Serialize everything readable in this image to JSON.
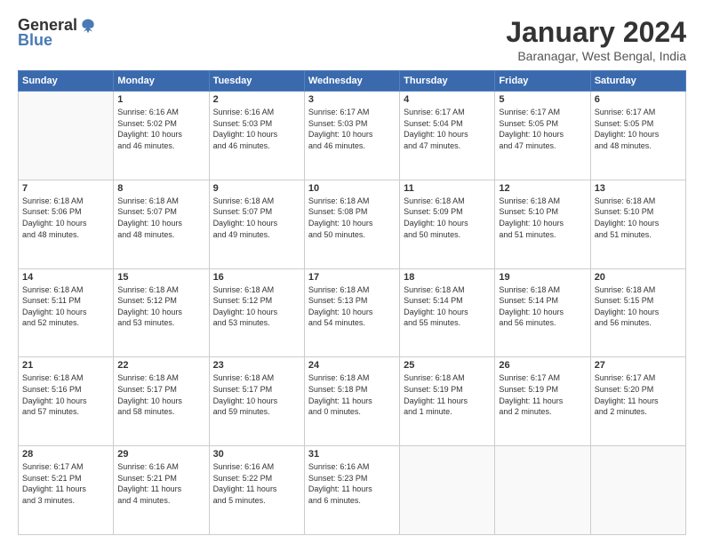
{
  "header": {
    "logo_general": "General",
    "logo_blue": "Blue",
    "month_title": "January 2024",
    "subtitle": "Baranagar, West Bengal, India"
  },
  "columns": [
    "Sunday",
    "Monday",
    "Tuesday",
    "Wednesday",
    "Thursday",
    "Friday",
    "Saturday"
  ],
  "weeks": [
    [
      {
        "day": "",
        "info": ""
      },
      {
        "day": "1",
        "info": "Sunrise: 6:16 AM\nSunset: 5:02 PM\nDaylight: 10 hours\nand 46 minutes."
      },
      {
        "day": "2",
        "info": "Sunrise: 6:16 AM\nSunset: 5:03 PM\nDaylight: 10 hours\nand 46 minutes."
      },
      {
        "day": "3",
        "info": "Sunrise: 6:17 AM\nSunset: 5:03 PM\nDaylight: 10 hours\nand 46 minutes."
      },
      {
        "day": "4",
        "info": "Sunrise: 6:17 AM\nSunset: 5:04 PM\nDaylight: 10 hours\nand 47 minutes."
      },
      {
        "day": "5",
        "info": "Sunrise: 6:17 AM\nSunset: 5:05 PM\nDaylight: 10 hours\nand 47 minutes."
      },
      {
        "day": "6",
        "info": "Sunrise: 6:17 AM\nSunset: 5:05 PM\nDaylight: 10 hours\nand 48 minutes."
      }
    ],
    [
      {
        "day": "7",
        "info": "Sunrise: 6:18 AM\nSunset: 5:06 PM\nDaylight: 10 hours\nand 48 minutes."
      },
      {
        "day": "8",
        "info": "Sunrise: 6:18 AM\nSunset: 5:07 PM\nDaylight: 10 hours\nand 48 minutes."
      },
      {
        "day": "9",
        "info": "Sunrise: 6:18 AM\nSunset: 5:07 PM\nDaylight: 10 hours\nand 49 minutes."
      },
      {
        "day": "10",
        "info": "Sunrise: 6:18 AM\nSunset: 5:08 PM\nDaylight: 10 hours\nand 50 minutes."
      },
      {
        "day": "11",
        "info": "Sunrise: 6:18 AM\nSunset: 5:09 PM\nDaylight: 10 hours\nand 50 minutes."
      },
      {
        "day": "12",
        "info": "Sunrise: 6:18 AM\nSunset: 5:10 PM\nDaylight: 10 hours\nand 51 minutes."
      },
      {
        "day": "13",
        "info": "Sunrise: 6:18 AM\nSunset: 5:10 PM\nDaylight: 10 hours\nand 51 minutes."
      }
    ],
    [
      {
        "day": "14",
        "info": "Sunrise: 6:18 AM\nSunset: 5:11 PM\nDaylight: 10 hours\nand 52 minutes."
      },
      {
        "day": "15",
        "info": "Sunrise: 6:18 AM\nSunset: 5:12 PM\nDaylight: 10 hours\nand 53 minutes."
      },
      {
        "day": "16",
        "info": "Sunrise: 6:18 AM\nSunset: 5:12 PM\nDaylight: 10 hours\nand 53 minutes."
      },
      {
        "day": "17",
        "info": "Sunrise: 6:18 AM\nSunset: 5:13 PM\nDaylight: 10 hours\nand 54 minutes."
      },
      {
        "day": "18",
        "info": "Sunrise: 6:18 AM\nSunset: 5:14 PM\nDaylight: 10 hours\nand 55 minutes."
      },
      {
        "day": "19",
        "info": "Sunrise: 6:18 AM\nSunset: 5:14 PM\nDaylight: 10 hours\nand 56 minutes."
      },
      {
        "day": "20",
        "info": "Sunrise: 6:18 AM\nSunset: 5:15 PM\nDaylight: 10 hours\nand 56 minutes."
      }
    ],
    [
      {
        "day": "21",
        "info": "Sunrise: 6:18 AM\nSunset: 5:16 PM\nDaylight: 10 hours\nand 57 minutes."
      },
      {
        "day": "22",
        "info": "Sunrise: 6:18 AM\nSunset: 5:17 PM\nDaylight: 10 hours\nand 58 minutes."
      },
      {
        "day": "23",
        "info": "Sunrise: 6:18 AM\nSunset: 5:17 PM\nDaylight: 10 hours\nand 59 minutes."
      },
      {
        "day": "24",
        "info": "Sunrise: 6:18 AM\nSunset: 5:18 PM\nDaylight: 11 hours\nand 0 minutes."
      },
      {
        "day": "25",
        "info": "Sunrise: 6:18 AM\nSunset: 5:19 PM\nDaylight: 11 hours\nand 1 minute."
      },
      {
        "day": "26",
        "info": "Sunrise: 6:17 AM\nSunset: 5:19 PM\nDaylight: 11 hours\nand 2 minutes."
      },
      {
        "day": "27",
        "info": "Sunrise: 6:17 AM\nSunset: 5:20 PM\nDaylight: 11 hours\nand 2 minutes."
      }
    ],
    [
      {
        "day": "28",
        "info": "Sunrise: 6:17 AM\nSunset: 5:21 PM\nDaylight: 11 hours\nand 3 minutes."
      },
      {
        "day": "29",
        "info": "Sunrise: 6:16 AM\nSunset: 5:21 PM\nDaylight: 11 hours\nand 4 minutes."
      },
      {
        "day": "30",
        "info": "Sunrise: 6:16 AM\nSunset: 5:22 PM\nDaylight: 11 hours\nand 5 minutes."
      },
      {
        "day": "31",
        "info": "Sunrise: 6:16 AM\nSunset: 5:23 PM\nDaylight: 11 hours\nand 6 minutes."
      },
      {
        "day": "",
        "info": ""
      },
      {
        "day": "",
        "info": ""
      },
      {
        "day": "",
        "info": ""
      }
    ]
  ]
}
